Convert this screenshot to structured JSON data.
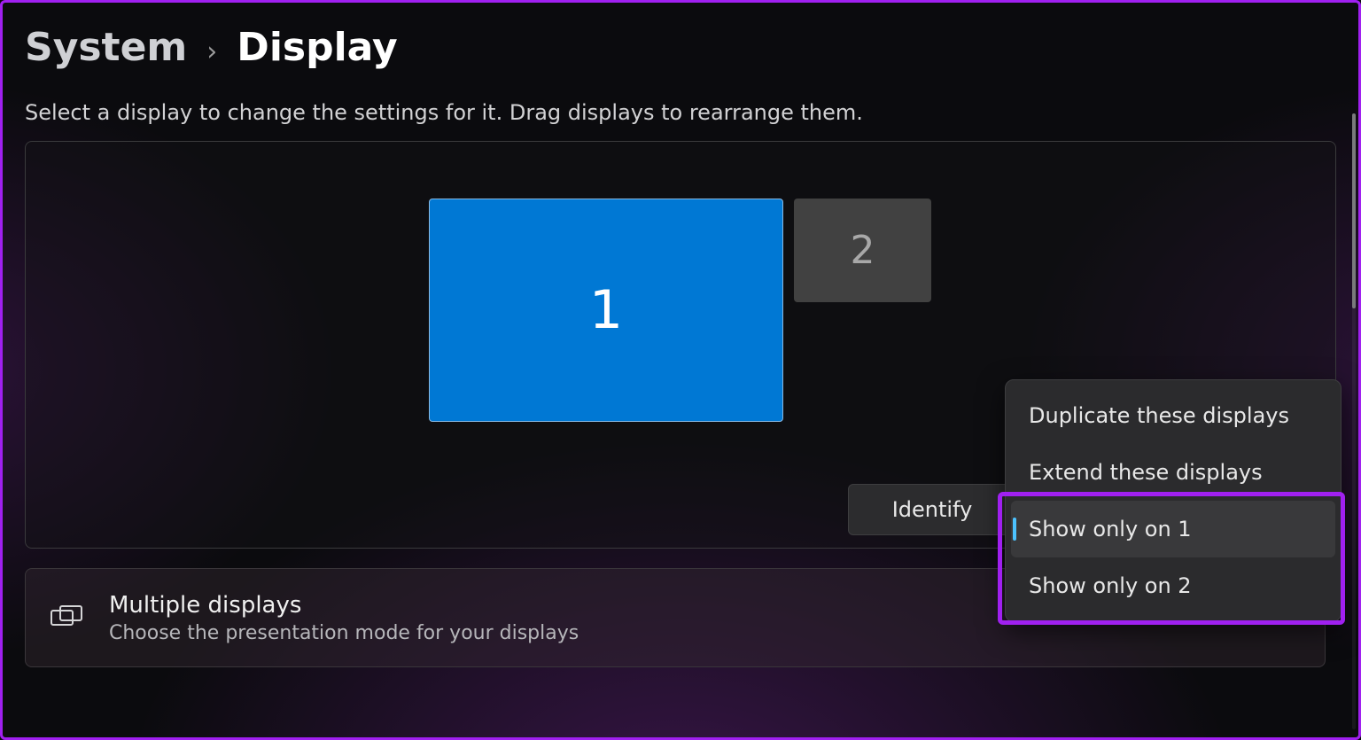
{
  "breadcrumb": {
    "parent": "System",
    "current": "Display"
  },
  "helper": "Select a display to change the settings for it. Drag displays to rearrange them.",
  "monitors": {
    "m1": "1",
    "m2": "2"
  },
  "buttons": {
    "identify": "Identify"
  },
  "menu": {
    "duplicate": "Duplicate these displays",
    "extend": "Extend these displays",
    "show1": "Show only on 1",
    "show2": "Show only on 2"
  },
  "multiple_displays": {
    "title": "Multiple displays",
    "subtitle": "Choose the presentation mode for your displays"
  }
}
